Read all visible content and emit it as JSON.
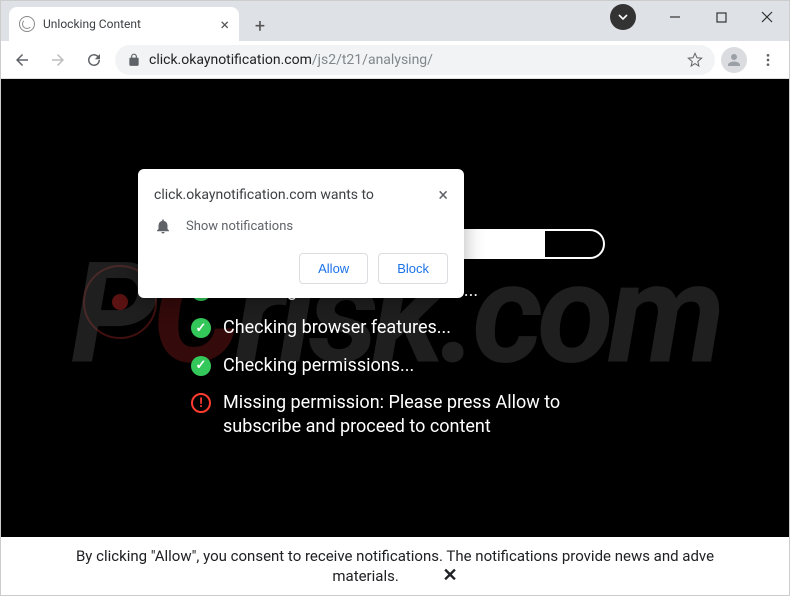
{
  "tab": {
    "title": "Unlocking Content"
  },
  "url": {
    "domain": "click.okaynotification.com",
    "path": "/js2/t21/analysing/"
  },
  "permission_popup": {
    "origin_wants": "click.okaynotification.com wants to",
    "prompt": "Show notifications",
    "allow": "Allow",
    "block": "Block"
  },
  "page": {
    "checks": [
      {
        "status": "ok",
        "text": "Checking browser information..."
      },
      {
        "status": "ok",
        "text": "Checking browser features..."
      },
      {
        "status": "ok",
        "text": "Checking permissions..."
      },
      {
        "status": "err",
        "text": "Missing permission: Please press Allow to subscribe and proceed to content"
      }
    ]
  },
  "consent": {
    "line1": "By clicking \"Allow\", you consent to receive notifications. The notifications provide news and adve",
    "line2": "materials."
  },
  "watermark": {
    "p": "P",
    "c": "C",
    "rest": "risk.com"
  }
}
